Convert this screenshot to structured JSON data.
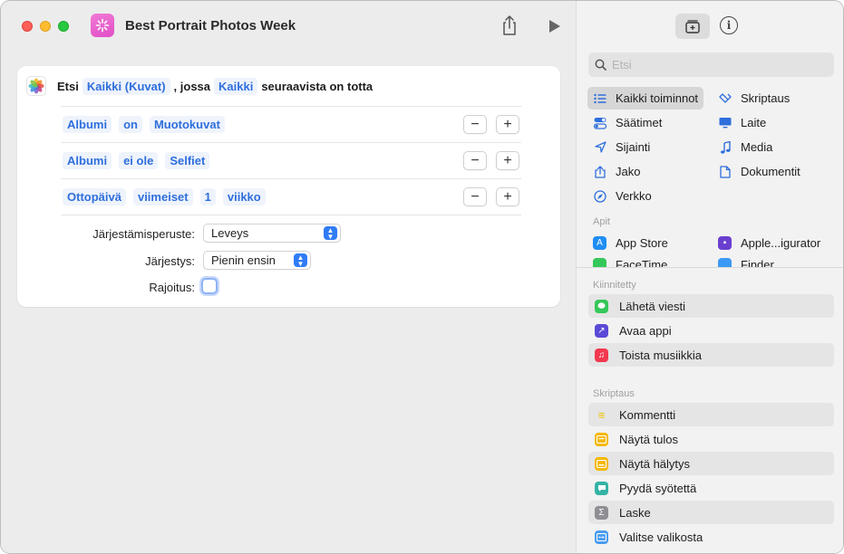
{
  "window": {
    "title": "Best Portrait Photos Week"
  },
  "colors": {
    "accent": "#2f6fdc",
    "token_bg": "#eef3fc",
    "app_icon": "#e85bcd"
  },
  "icons": {
    "app": "shortcut-icon",
    "share": "share-icon",
    "play": "play-icon",
    "library": "library-icon",
    "info": "info-icon",
    "search": "search-icon"
  },
  "find": {
    "verb": "Etsi",
    "target": "Kaikki (Kuvat)",
    "joiner": ", jossa",
    "mode": "Kaikki",
    "suffix": "seuraavista on totta"
  },
  "conditions": [
    {
      "field": "Albumi",
      "operator": "on",
      "value": "Muotokuvat"
    },
    {
      "field": "Albumi",
      "operator": "ei ole",
      "value": "Selfiet"
    },
    {
      "field": "Ottopäivä",
      "operator": "viimeiset",
      "value": "1",
      "unit": "viikko"
    }
  ],
  "buttons": {
    "minus": "−",
    "plus": "+"
  },
  "options": {
    "sort_label": "Järjestämisperuste:",
    "sort_value": "Leveys",
    "order_label": "Järjestys:",
    "order_value": "Pienin ensin",
    "limit_label": "Rajoitus:"
  },
  "sidebar": {
    "search_placeholder": "Etsi",
    "categories": [
      {
        "label": "Kaikki toiminnot",
        "icon": "list-icon"
      },
      {
        "label": "Skriptaus",
        "icon": "script-icon"
      },
      {
        "label": "Säätimet",
        "icon": "toggle-icon"
      },
      {
        "label": "Laite",
        "icon": "display-icon"
      },
      {
        "label": "Sijainti",
        "icon": "location-icon"
      },
      {
        "label": "Media",
        "icon": "music-note-icon"
      },
      {
        "label": "Jako",
        "icon": "share-icon"
      },
      {
        "label": "Dokumentit",
        "icon": "document-icon"
      },
      {
        "label": "Verkko",
        "icon": "compass-icon"
      }
    ],
    "apps_label": "Apit",
    "apps": [
      {
        "label": "App Store",
        "icon": "app-store-icon"
      },
      {
        "label": "Apple...igurator",
        "icon": "apple-configurator-icon"
      },
      {
        "label": "FaceTime",
        "icon": "facetime-icon"
      },
      {
        "label": "Finder",
        "icon": "finder-icon"
      }
    ],
    "pinned_label": "Kiinnitetty",
    "pinned": [
      {
        "label": "Lähetä viesti",
        "icon": "messages-icon"
      },
      {
        "label": "Avaa appi",
        "icon": "open-app-icon"
      },
      {
        "label": "Toista musiikkia",
        "icon": "music-icon"
      }
    ],
    "scripting_label": "Skriptaus",
    "scripting": [
      {
        "label": "Kommentti",
        "icon": "comment-icon"
      },
      {
        "label": "Näytä tulos",
        "icon": "show-result-icon"
      },
      {
        "label": "Näytä hälytys",
        "icon": "alert-icon"
      },
      {
        "label": "Pyydä syötettä",
        "icon": "ask-input-icon"
      },
      {
        "label": "Laske",
        "icon": "calculate-icon"
      },
      {
        "label": "Valitse valikosta",
        "icon": "menu-icon"
      }
    ]
  }
}
